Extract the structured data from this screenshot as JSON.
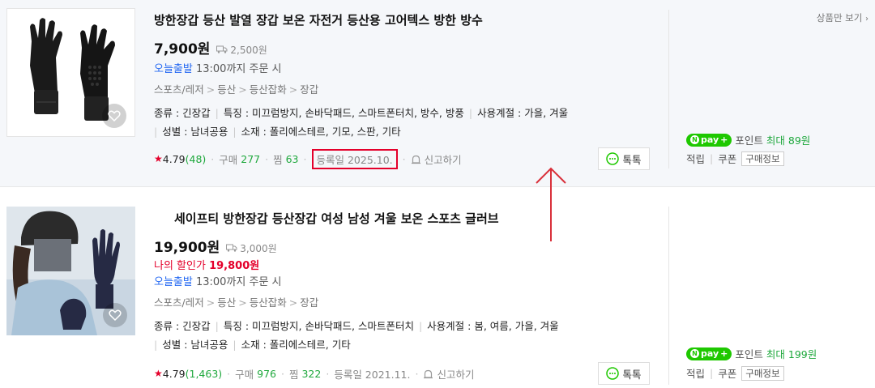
{
  "header": {
    "only_products_label": "상품만 보기"
  },
  "items": [
    {
      "title": "방한장갑 등산 발열 장갑 보온 자전거 등산용 고어텍스 방한 방수",
      "price": "7,900원",
      "shipping": "2,500원",
      "delivery_highlight": "오늘출발",
      "delivery_text": "13:00까지 주문 시",
      "category": [
        "스포츠/레저",
        "등산",
        "등산잡화",
        "장갑"
      ],
      "specs_line1": [
        "종류 : 긴장갑",
        "특징 : 미끄럼방지, 손바닥패드, 스마트폰터치, 방수, 방풍",
        "사용계절 : 가을, 겨울"
      ],
      "specs_line2": [
        "성별 : 남녀공용",
        "소재 : 폴리에스테르, 기모, 스판, 기타"
      ],
      "rating": "4.79",
      "reviews": "(48)",
      "purchase_label": "구매",
      "purchase_count": "277",
      "wish_label": "찜",
      "wish_count": "63",
      "registered": "등록일 2025.10.",
      "report_label": "신고하기",
      "talk_label": "톡톡",
      "npay_point_label": "포인트",
      "npay_max_label": "최대",
      "npay_point": "89원",
      "save_label": "적립",
      "coupon_label": "쿠폰",
      "purchase_info_label": "구매정보"
    },
    {
      "title": "세이프티 방한장갑 등산장갑 여성 남성 겨울 보온 스포츠 글러브",
      "price": "19,900원",
      "shipping": "3,000원",
      "discount_label": "나의 할인가",
      "discount_price": "19,800원",
      "delivery_highlight": "오늘출발",
      "delivery_text": "13:00까지 주문 시",
      "category": [
        "스포츠/레저",
        "등산",
        "등산잡화",
        "장갑"
      ],
      "specs_line1": [
        "종류 : 긴장갑",
        "특징 : 미끄럼방지, 손바닥패드, 스마트폰터치",
        "사용계절 : 봄, 여름, 가을, 겨울"
      ],
      "specs_line2": [
        "성별 : 남녀공용",
        "소재 : 폴리에스테르, 기타"
      ],
      "rating": "4.79",
      "reviews": "(1,463)",
      "purchase_label": "구매",
      "purchase_count": "976",
      "wish_label": "찜",
      "wish_count": "322",
      "registered": "등록일 2021.11.",
      "report_label": "신고하기",
      "talk_label": "톡톡",
      "npay_point_label": "포인트",
      "npay_max_label": "최대",
      "npay_point": "199원",
      "save_label": "적립",
      "coupon_label": "쿠폰",
      "purchase_info_label": "구매정보"
    }
  ],
  "npay_badge_text": "pay",
  "colors": {
    "accent_red": "#e4002b",
    "npay_green": "#1ec800",
    "link_blue": "#2468f2",
    "count_green": "#1ea83c"
  }
}
